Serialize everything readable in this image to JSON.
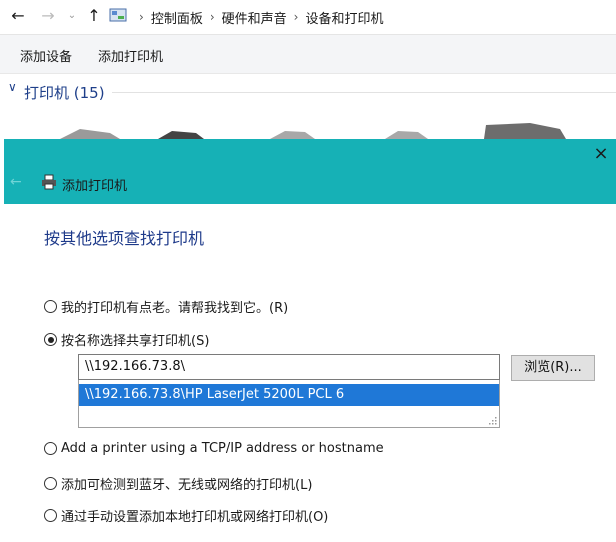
{
  "explorer": {
    "breadcrumbs": [
      "控制面板",
      "硬件和声音",
      "设备和打印机"
    ],
    "commands": {
      "add_device": "添加设备",
      "add_printer": "添加打印机"
    },
    "group_header": "打印机 (15)"
  },
  "dialog": {
    "title": "添加打印机",
    "close": "×",
    "heading": "按其他选项查找打印机",
    "options": [
      {
        "label": "我的打印机有点老。请帮我找到它。(R)",
        "selected": false
      },
      {
        "label": "按名称选择共享打印机(S)",
        "selected": true
      },
      {
        "label": "Add a printer using a TCP/IP address or hostname",
        "selected": false
      },
      {
        "label": "添加可检测到蓝牙、无线或网络的打印机(L)",
        "selected": false
      },
      {
        "label": "通过手动设置添加本地打印机或网络打印机(O)",
        "selected": false
      }
    ],
    "share_input_value": "\\\\192.166.73.8\\",
    "suggestion": "\\\\192.166.73.8\\HP LaserJet 5200L PCL 6",
    "browse_label": "浏览(R)..."
  },
  "colors": {
    "title_bar": "#16b1b6",
    "selection": "#1f78d7",
    "heading": "#1e3a8a"
  }
}
